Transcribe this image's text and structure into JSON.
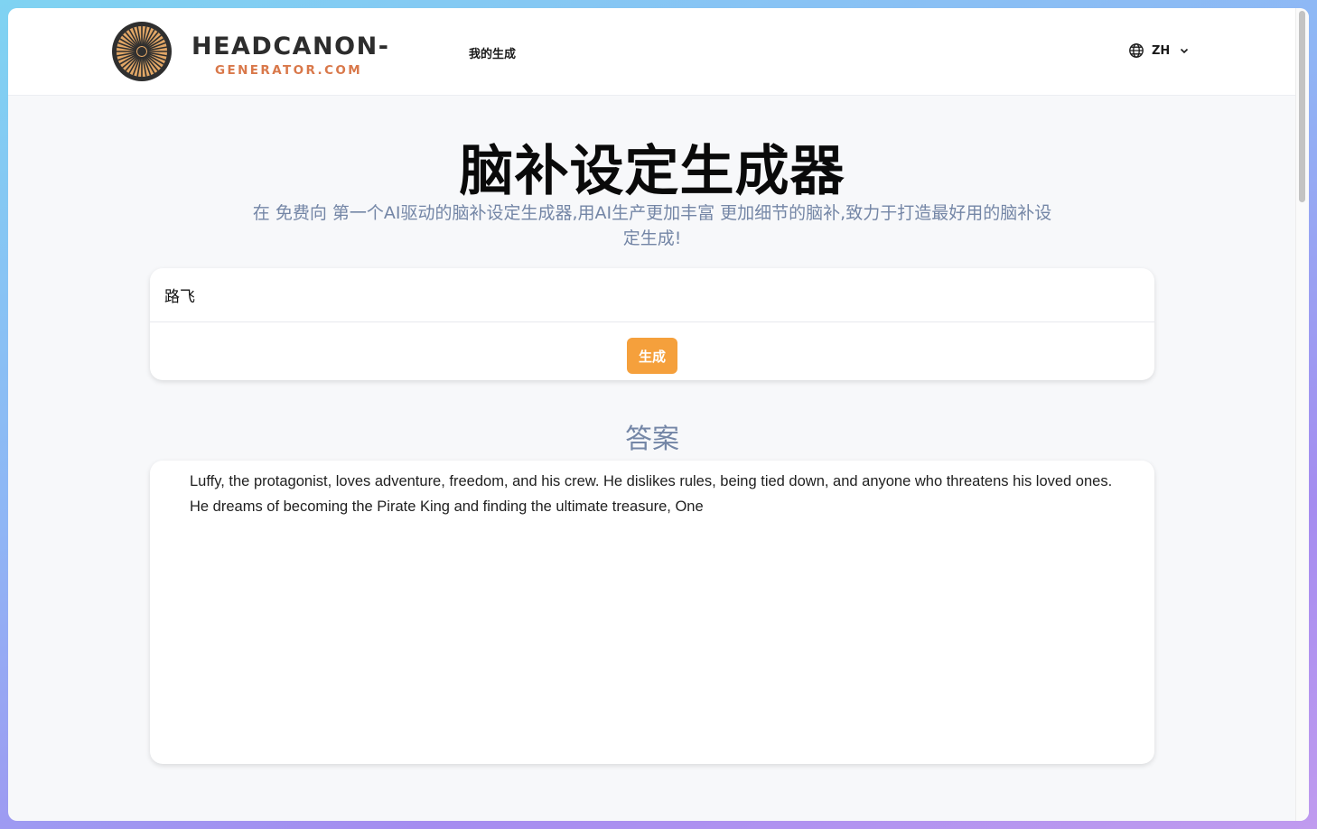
{
  "header": {
    "brand_main": "HEADCANON-",
    "brand_sub": "GENERATOR.COM",
    "nav_my_generations": "我的生成",
    "language": "ZH"
  },
  "hero": {
    "title": "脑补设定生成器",
    "subtitle": "在 免费向 第一个AI驱动的脑补设定生成器,用AI生产更加丰富 更加细节的脑补,致力于打造最好用的脑补设定生成!"
  },
  "form": {
    "input_value": "路飞",
    "generate_label": "生成"
  },
  "answer": {
    "heading": "答案",
    "text": "Luffy, the protagonist, loves adventure, freedom, and his crew. He dislikes rules, being tied down, and anyone who threatens his loved ones. He dreams of becoming the Pirate King and finding the ultimate treasure, One"
  },
  "colors": {
    "accent": "#f5a03c",
    "brand_sub": "#d9784a",
    "muted_text": "#7486a6"
  },
  "icons": {
    "logo": "sun-wheel-logo",
    "language": "globe-icon",
    "dropdown": "chevron-down-icon"
  }
}
